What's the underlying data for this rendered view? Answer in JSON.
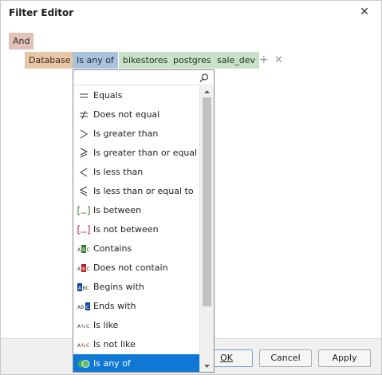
{
  "window": {
    "title": "Filter Editor"
  },
  "filter": {
    "group_operator": "And",
    "field": "Database",
    "operator": "Is any of",
    "values": [
      "bikestores",
      "postgres",
      "sale_dev"
    ]
  },
  "dropdown": {
    "search_value": "",
    "items": [
      {
        "label": "Equals",
        "icon": "equals-icon"
      },
      {
        "label": "Does not equal",
        "icon": "not-equal-icon"
      },
      {
        "label": "Is greater than",
        "icon": "greater-than-icon"
      },
      {
        "label": "Is greater than or equal to",
        "icon": "greater-or-equal-icon"
      },
      {
        "label": "Is less than",
        "icon": "less-than-icon"
      },
      {
        "label": "Is less than or equal to",
        "icon": "less-or-equal-icon"
      },
      {
        "label": "Is between",
        "icon": "between-icon"
      },
      {
        "label": "Is not between",
        "icon": "not-between-icon"
      },
      {
        "label": "Contains",
        "icon": "contains-icon"
      },
      {
        "label": "Does not contain",
        "icon": "does-not-contain-icon"
      },
      {
        "label": "Begins with",
        "icon": "begins-with-icon"
      },
      {
        "label": "Ends with",
        "icon": "ends-with-icon"
      },
      {
        "label": "Is like",
        "icon": "like-icon"
      },
      {
        "label": "Is not like",
        "icon": "not-like-icon"
      },
      {
        "label": "Is any of",
        "icon": "any-of-icon"
      }
    ],
    "selected": "Is any of"
  },
  "footer": {
    "ok_label": "OK",
    "cancel_label": "Cancel",
    "apply_label": "Apply"
  },
  "colors": {
    "group_chip": "#e3c1bb",
    "field_chip": "#e7c7a6",
    "operator_chip": "#a9c3dd",
    "value_chip": "#c9e1c8",
    "selection": "#0f78d7"
  }
}
